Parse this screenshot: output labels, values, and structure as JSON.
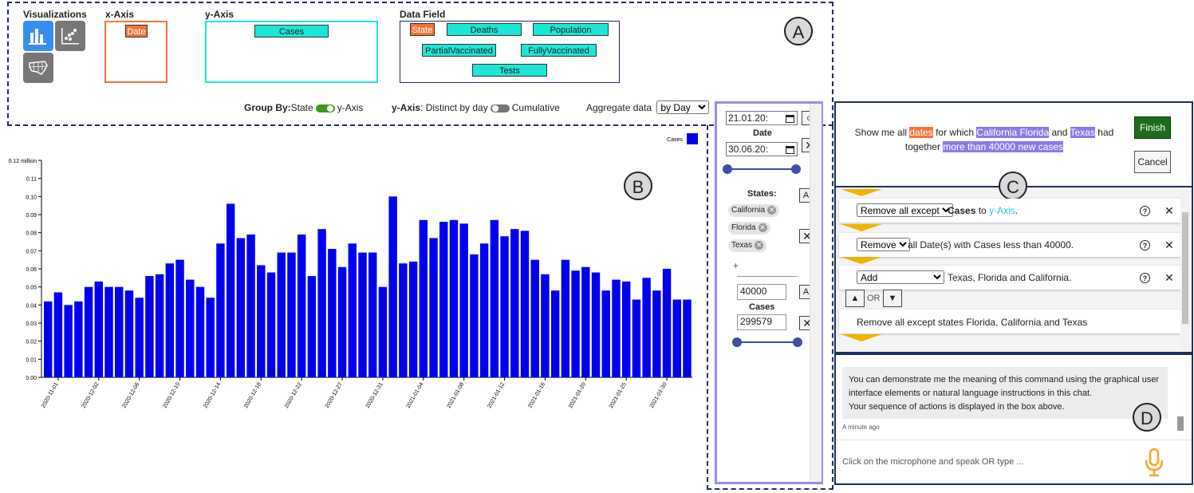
{
  "region_labels": {
    "a": "A",
    "b": "B",
    "c": "C",
    "d": "D"
  },
  "viz_panel": {
    "visualizations_label": "Visualizations",
    "xaxis_label": "x-Axis",
    "yaxis_label": "y-Axis",
    "datafield_label": "Data Field",
    "x_chip": "Date",
    "y_chip": "Cases",
    "fields": [
      "State",
      "Deaths",
      "Population",
      "PartialVaccinated",
      "FullyVaccinated",
      "Tests"
    ]
  },
  "controls": {
    "groupby_label": "Group By:",
    "groupby_a": "State",
    "groupby_b": "y-Axis",
    "yaxis_label": "y-Axis",
    "yaxis_a": ": Distinct by day",
    "yaxis_b": "Cumulative",
    "aggregate_label": "Aggregate data",
    "aggregate_value": "by Day"
  },
  "chart_data": {
    "type": "bar",
    "legend": "Cases",
    "ylim": [
      0,
      0.12
    ],
    "ytick_labels": [
      "0.00",
      "0.01",
      "0.02",
      "0.03",
      "0.04",
      "0.05",
      "0.06",
      "0.07",
      "0.08",
      "0.09",
      "0.10",
      "0.11",
      "0.12 million"
    ],
    "series": [
      {
        "name": "Cases",
        "color": "#0000ee",
        "values": [
          0.042,
          0.047,
          0.04,
          0.042,
          0.05,
          0.053,
          0.05,
          0.05,
          0.048,
          0.044,
          0.056,
          0.057,
          0.063,
          0.065,
          0.054,
          0.05,
          0.044,
          0.074,
          0.096,
          0.077,
          0.079,
          0.062,
          0.058,
          0.069,
          0.069,
          0.079,
          0.056,
          0.082,
          0.071,
          0.061,
          0.074,
          0.069,
          0.069,
          0.05,
          0.1,
          0.063,
          0.064,
          0.087,
          0.077,
          0.086,
          0.087,
          0.085,
          0.068,
          0.074,
          0.087,
          0.078,
          0.082,
          0.081,
          0.065,
          0.057,
          0.048,
          0.065,
          0.059,
          0.061,
          0.058,
          0.048,
          0.054,
          0.053,
          0.043,
          0.055,
          0.048,
          0.06,
          0.043,
          0.043
        ]
      }
    ],
    "xtick_labels": [
      "2020-11-01",
      "2020-12-02",
      "2020-12-06",
      "2020-12-10",
      "2020-12-14",
      "2020-12-18",
      "2020-12-22",
      "2020-12-27",
      "2020-12-31",
      "2021-01-04",
      "2021-01-08",
      "2021-01-12",
      "2021-01-16",
      "2021-01-20",
      "2021-01-25",
      "2021-01-30"
    ]
  },
  "filters": {
    "date_from": "21.01.20:",
    "date_label": "Date",
    "date_to": "30.06.20:",
    "states_label": "States:",
    "states": [
      "California",
      "Florida",
      "Texas"
    ],
    "add_sign": "+",
    "all_label": "All",
    "cases_min": "40000",
    "cases_label": "Cases",
    "cases_max": "299579"
  },
  "command": {
    "p1": "Show me all ",
    "h1": "dates",
    "p2": " for which ",
    "h2": "California Florida",
    "p3": " and ",
    "h3": "Texas",
    "p4": " had",
    "p5": "together ",
    "h4": "more than 40000 new cases",
    "finish": "Finish",
    "cancel": "Cancel"
  },
  "steps": [
    {
      "op": "Remove all except",
      "bold": "Cases",
      "mid": " to ",
      "link": "y-Axis",
      "end": "."
    },
    {
      "op": "Remove",
      "text": "all Date(s) with Cases less than 40000."
    },
    {
      "op": "Add",
      "text": "Texas, Florida and California."
    }
  ],
  "or_label": "OR",
  "alt_text": "Remove all except states Florida, California and Texas",
  "chat": {
    "line1": "You can demonstrate me the meaning of this command using the graphical user",
    "line2": "interface elements or natural language instructions in this chat.",
    "line3": "Your sequence of actions is displayed in the box above.",
    "time": "A minute ago",
    "placeholder": "Click on the microphone and speak OR type ..."
  }
}
